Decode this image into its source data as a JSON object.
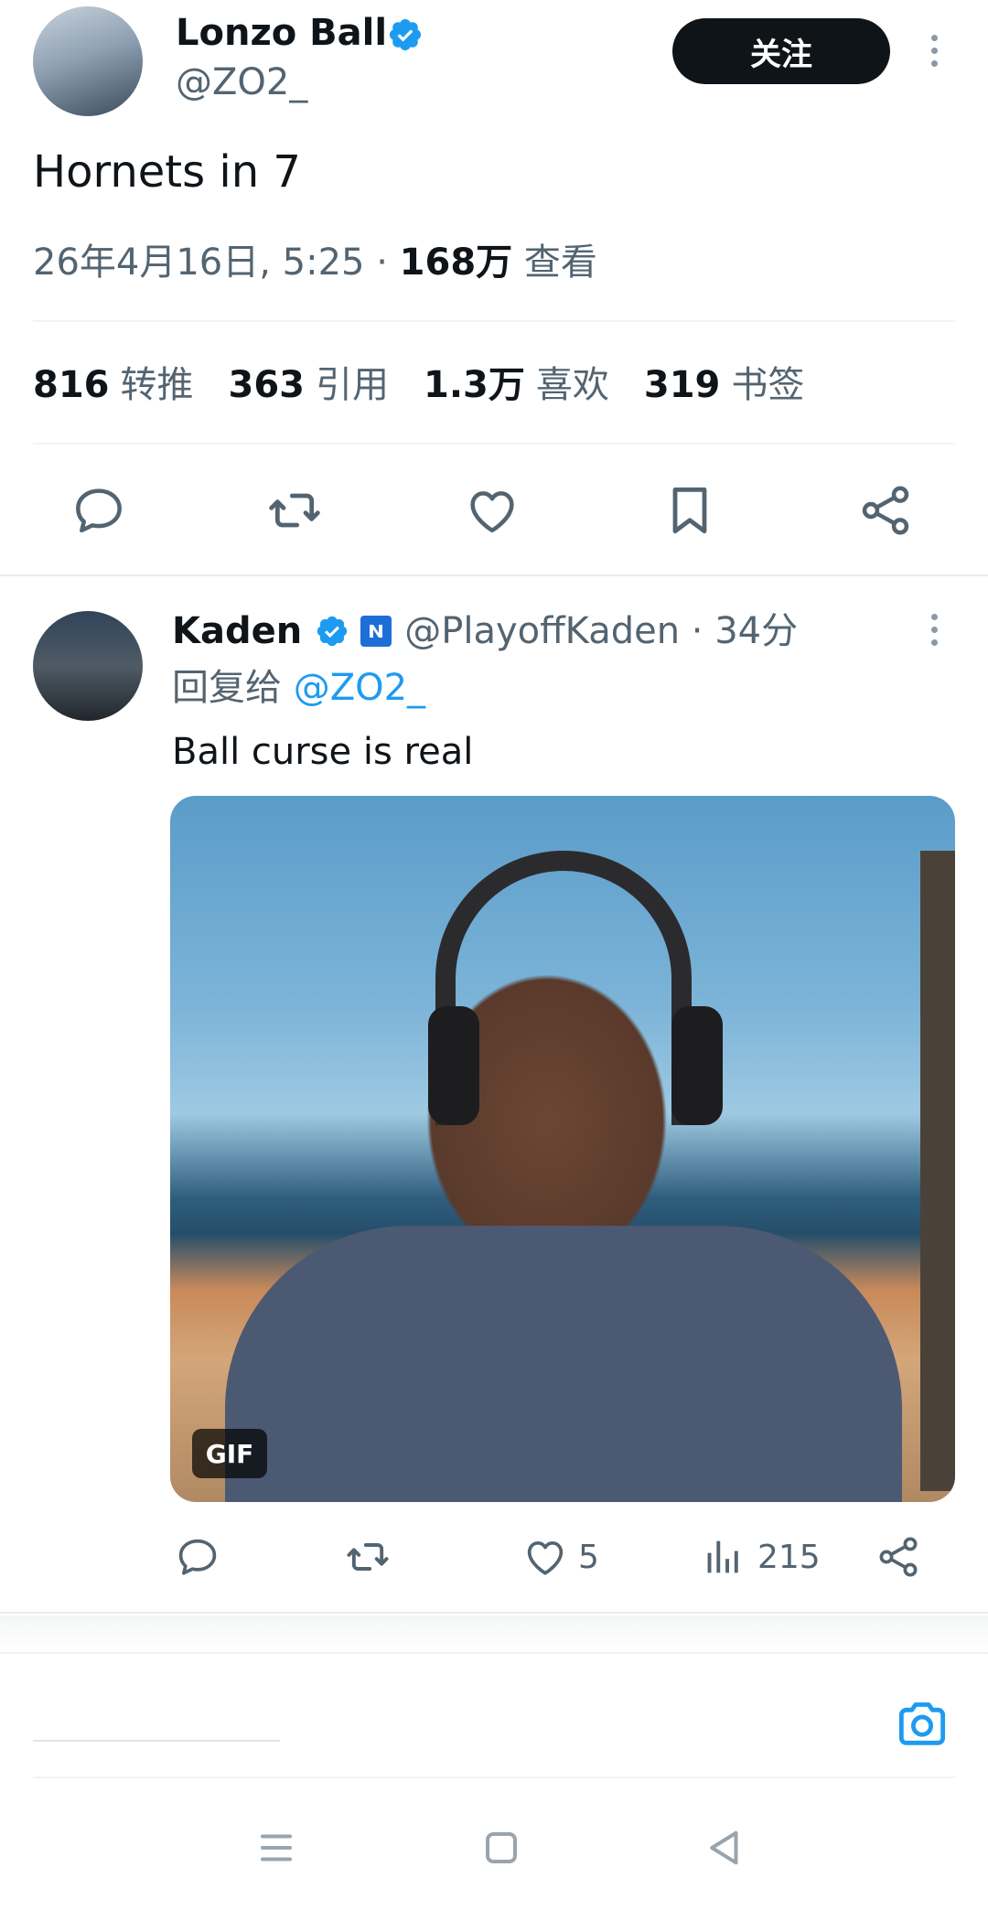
{
  "main_tweet": {
    "author_name": "Lonzo Ball",
    "handle": "@ZO2_",
    "follow_label": "关注",
    "text": "Hornets in 7",
    "timestamp": "26年4月16日, 5:25 · ",
    "views_count": "168万",
    "views_label": " 查看",
    "stats": [
      {
        "count": "816",
        "label": "转推"
      },
      {
        "count": "363",
        "label": "引用"
      },
      {
        "count": "1.3万",
        "label": "喜欢"
      },
      {
        "count": "319",
        "label": "书签"
      }
    ],
    "actions": [
      "reply-icon",
      "retweet-icon",
      "like-icon",
      "bookmark-icon",
      "share-icon"
    ]
  },
  "reply": {
    "author_name": "Kaden",
    "handle_time": "@PlayoffKaden · 34分",
    "reply_to_prefix": "回复给 ",
    "reply_to_handle": "@ZO2_",
    "text": "Ball curse is real",
    "media_label": "GIF",
    "like_count": "5",
    "view_count": "215"
  },
  "compose": {
    "placeholder": ""
  },
  "colors": {
    "accent": "#1d9bf0",
    "text": "#0f1419",
    "muted": "#536471",
    "follow_bg": "#0f1419"
  }
}
